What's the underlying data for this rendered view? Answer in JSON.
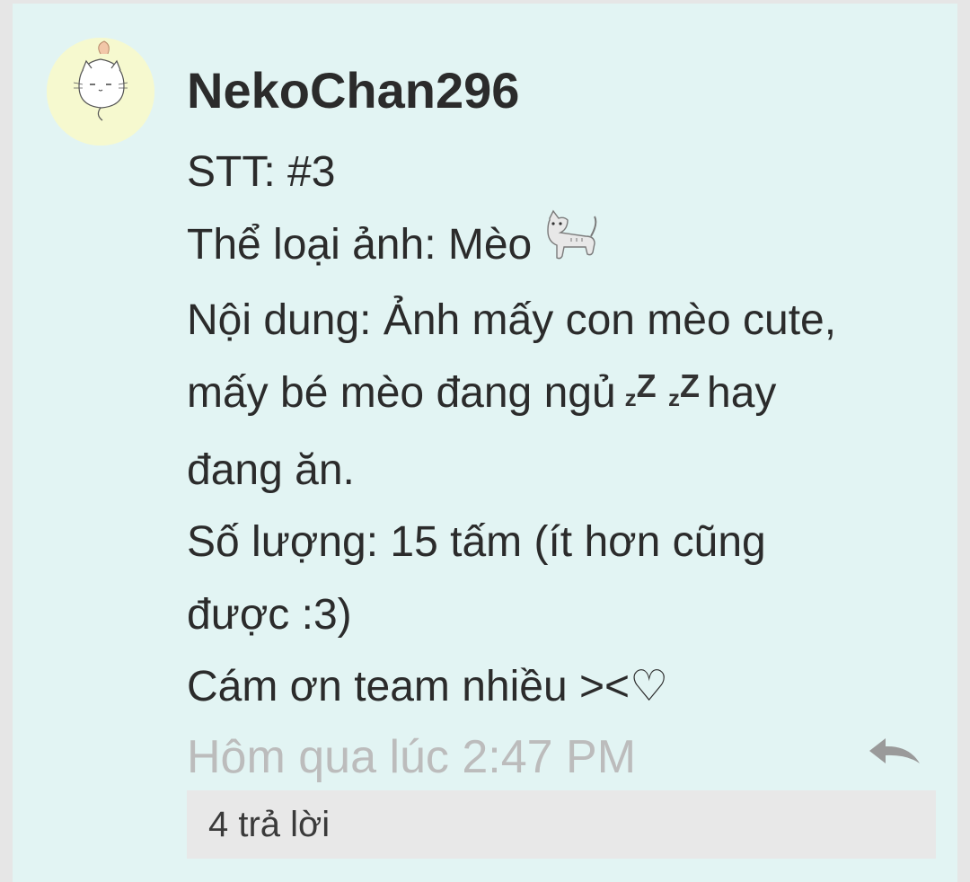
{
  "post": {
    "username": "NekoChan296",
    "lines": {
      "stt": "STT: #3",
      "category": "Thể loại ảnh: Mèo",
      "content_1": "Nội dung: Ảnh mấy con mèo cute,",
      "content_2a": "mấy bé mèo đang ngủ",
      "content_2b": "hay",
      "content_3": "đang ăn.",
      "quantity_1": "Số lượng: 15 tấm (ít hơn cũng",
      "quantity_2": "được :3)",
      "thanks": "Cám ơn team nhiều ><♡"
    },
    "zzz": {
      "small": "z",
      "big": "Z"
    },
    "timestamp": "Hôm qua lúc 2:47 PM",
    "reply_count_label": "4 trả lời"
  },
  "icons": {
    "avatar": "cat-avatar-icon",
    "cat_emoji": "cat-emoji-icon",
    "sleep_emoji": "zzz-icon",
    "reply": "reply-arrow-icon"
  },
  "colors": {
    "card_background": "#e2f4f3",
    "avatar_background": "#f6f9cf",
    "text": "#2b2b2b",
    "timestamp": "#bcbcbc",
    "reply_bar": "#e8e8e8",
    "reply_icon": "#9a9a9a"
  }
}
